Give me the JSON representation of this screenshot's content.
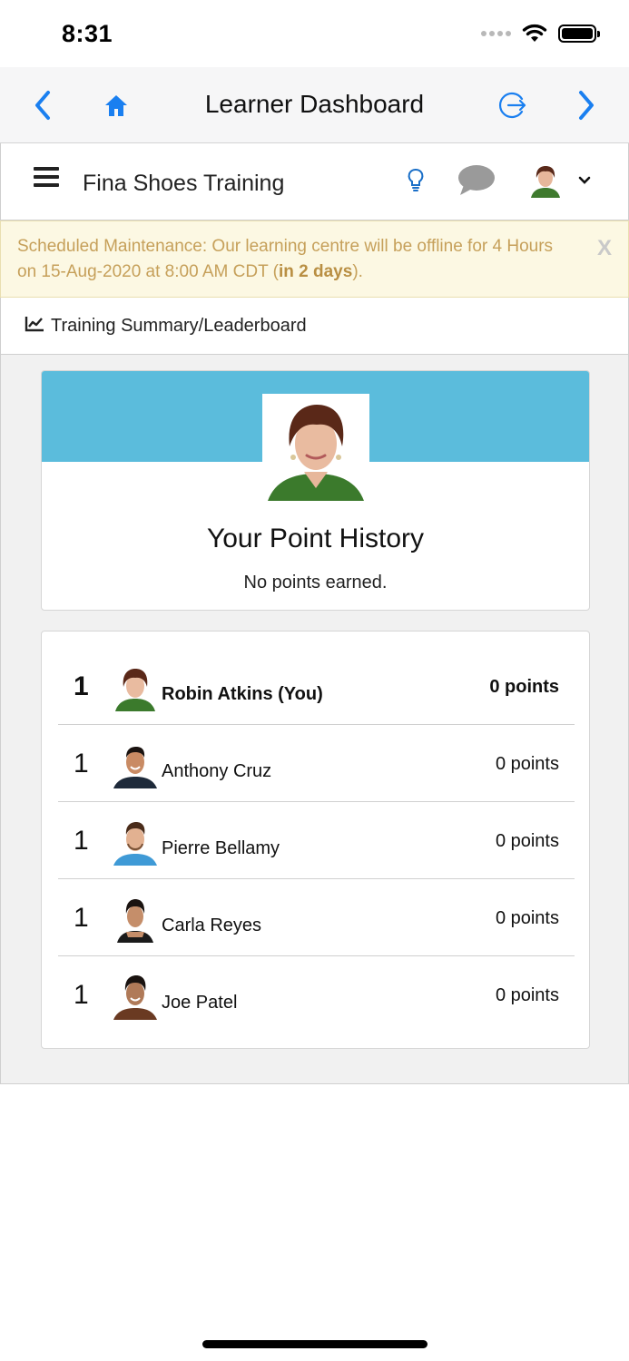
{
  "status_bar": {
    "time": "8:31"
  },
  "nav": {
    "title": "Learner Dashboard",
    "back_icon": "chevron-left-icon",
    "home_icon": "home-icon",
    "logout_icon": "logout-icon",
    "forward_icon": "chevron-right-icon",
    "accent_color": "#1a7ff0"
  },
  "course_header": {
    "title": "Fina Shoes Training",
    "menu_icon": "hamburger-menu-icon",
    "tips_icon": "lightbulb-icon",
    "chat_icon": "chat-bubble-icon",
    "dropdown_icon": "chevron-down-icon"
  },
  "banner": {
    "text_before": "Scheduled Maintenance: Our learning centre will be offline for 4 Hours on 15-Aug-2020 at 8:00 AM CDT (",
    "text_bold": "in 2 days",
    "text_after": ").",
    "close_label": "X",
    "background_color": "#fcf8e3",
    "text_color": "#c6a05a"
  },
  "section": {
    "title": "Training Summary/Leaderboard",
    "icon": "line-chart-icon"
  },
  "profile_card": {
    "heading": "Your Point History",
    "subtext": "No points earned.",
    "banner_color": "#5bbcdc"
  },
  "leaderboard": [
    {
      "rank": "1",
      "name": "Robin Atkins (You)",
      "points": "0 points",
      "is_current_user": true
    },
    {
      "rank": "1",
      "name": "Anthony Cruz",
      "points": "0 points",
      "is_current_user": false
    },
    {
      "rank": "1",
      "name": "Pierre Bellamy",
      "points": "0 points",
      "is_current_user": false
    },
    {
      "rank": "1",
      "name": "Carla Reyes",
      "points": "0 points",
      "is_current_user": false
    },
    {
      "rank": "1",
      "name": "Joe Patel",
      "points": "0 points",
      "is_current_user": false
    }
  ]
}
